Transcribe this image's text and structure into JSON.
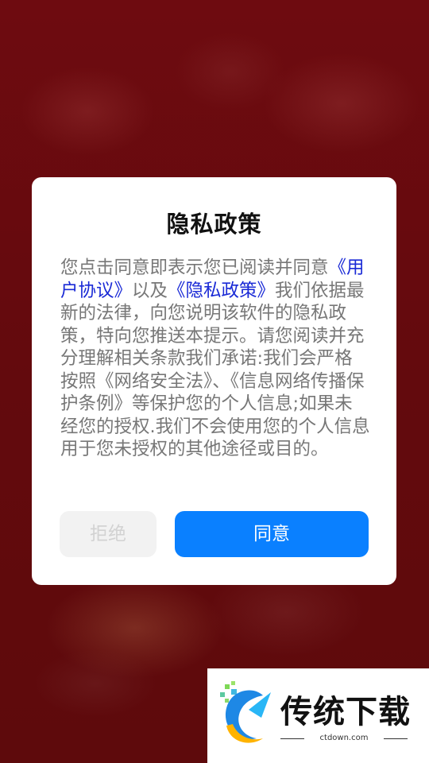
{
  "dialog": {
    "title": "隐私政策",
    "body": {
      "intro": "您点击同意即表示您已阅读并同意",
      "user_agreement_link": "《用户协议》",
      "and": "以及",
      "privacy_policy_link": "《隐私政策》",
      "rest": "我们依据最新的法律，向您说明该软件的隐私政策，特向您推送本提示。请您阅读并充分理解相关条款我们承诺:我们会严格按照《网络安全法》、《信息网络传播保护条例》等保护您的个人信息;如果未经您的授权.我们不会使用您的个人信息用于您未授权的其他途径或目的。"
    },
    "reject_label": "拒绝",
    "agree_label": "同意"
  },
  "watermark": {
    "brand": "传统下载",
    "url": "ctdown.com"
  },
  "colors": {
    "background": "#6a0a0e",
    "link": "#1a2ad6",
    "agree_button": "#0a80ff",
    "reject_button": "#f2f2f2"
  }
}
